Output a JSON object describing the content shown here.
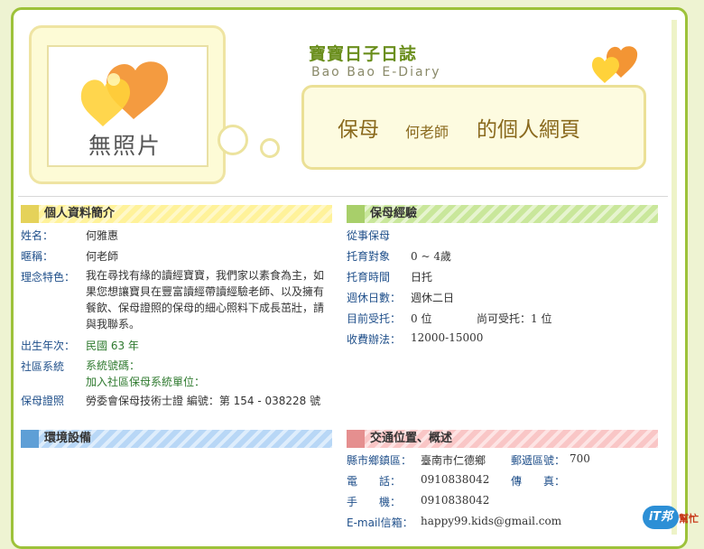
{
  "colors": {
    "accent": "#9dc23a",
    "label_blue": "#1f4f8a",
    "title_brown": "#8a6a1e",
    "heart_orange": "#f28a1e",
    "heart_yellow": "#ffd23a"
  },
  "header": {
    "photo_placeholder": "無照片",
    "site_title": "寶寶日子日誌",
    "site_subtitle": "Bao Bao E-Diary",
    "page_title_prefix": "保母",
    "nanny_name": "何老師",
    "page_title_suffix": "的個人網頁",
    "logo_icon": "heart-icon"
  },
  "profile": {
    "heading": "個人資料簡介",
    "name_label": "姓名：",
    "name_value": "何雅惠",
    "nickname_label": "暱稱：",
    "nickname_value": "何老師",
    "philosophy_label": "理念特色：",
    "philosophy_value": "我在尋找有緣的讀經寶寶，我們家以素食為主，如果您想讓寶貝在豐富讀經帶讀經驗老師、以及擁有餐飲、保母證照的保母的細心照料下成長茁壯，請與我聯系。",
    "birth_label": "出生年次：",
    "birth_value": "民國 63 年",
    "community_label": "社區系統",
    "system_code_label": "系統號碼：",
    "join_unit_label": "加入社區保母系統單位：",
    "license_label": "保母證照",
    "license_value": "勞委會保母技術士證 編號：第 154 - 038228 號"
  },
  "experience": {
    "heading": "保母經驗",
    "work_label": "從事保母",
    "target_label": "托育對象",
    "target_value": "0 ~ 4歲",
    "time_label": "托育時間",
    "time_value": "日托",
    "rest_label": "週休日數：",
    "rest_value": "週休二日",
    "current_label": "目前受托：",
    "current_value": "0 位",
    "available_label": "尚可受托：",
    "available_value": "1 位",
    "fee_label": "收費辦法：",
    "fee_value": "12000-15000"
  },
  "environment": {
    "heading": "環境設備"
  },
  "location": {
    "heading": "交通位置、概述",
    "district_label": "縣市鄉鎮區：",
    "district_value": "臺南市仁德鄉",
    "zip_label": "郵遞區號：",
    "zip_value": "700",
    "phone_label": "電　　話：",
    "phone_value": "0910838042",
    "fax_label": "傳　　真：",
    "mobile_label": "手　　機：",
    "mobile_value": "0910838042",
    "email_label": "E-mail信箱：",
    "email_value": "happy99.kids@gmail.com"
  },
  "corner_badge": {
    "text": "iT邦",
    "suffix": "幫忙"
  }
}
